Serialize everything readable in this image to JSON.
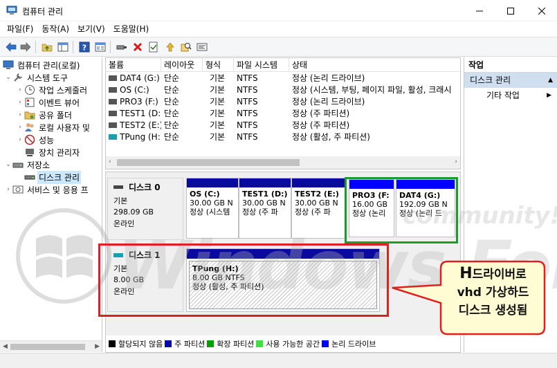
{
  "window": {
    "title": "컴퓨터 관리",
    "icon": "computer-management-icon"
  },
  "menu": [
    "파일(F)",
    "동작(A)",
    "보기(V)",
    "도움말(H)"
  ],
  "toolbar": [
    "back-arrow-icon",
    "forward-arrow-icon",
    "up-folder-icon",
    "show-hide-tree-icon",
    "help-icon",
    "properties-icon",
    "connect-icon",
    "delete-icon",
    "check-icon",
    "upload-icon",
    "search-icon",
    "settings-icon"
  ],
  "tree": {
    "root": "컴퓨터 관리(로컬)",
    "items": [
      {
        "label": "시스템 도구",
        "level": 1,
        "expanded": true,
        "icon": "tools-icon"
      },
      {
        "label": "작업 스케줄러",
        "level": 2,
        "icon": "clock-icon"
      },
      {
        "label": "이벤트 뷰어",
        "level": 2,
        "icon": "event-viewer-icon"
      },
      {
        "label": "공유 폴더",
        "level": 2,
        "icon": "shared-folder-icon"
      },
      {
        "label": "로컬 사용자 및",
        "level": 2,
        "icon": "users-icon"
      },
      {
        "label": "성능",
        "level": 2,
        "icon": "performance-icon"
      },
      {
        "label": "장치 관리자",
        "level": 2,
        "icon": "device-manager-icon"
      },
      {
        "label": "저장소",
        "level": 1,
        "expanded": true,
        "icon": "storage-icon"
      },
      {
        "label": "디스크 관리",
        "level": 2,
        "selected": true,
        "icon": "disk-icon"
      },
      {
        "label": "서비스 및 응용 프",
        "level": 1,
        "icon": "services-icon"
      }
    ]
  },
  "volumes": {
    "columns": [
      "볼륨",
      "레이아웃",
      "형식",
      "파일 시스템",
      "상태"
    ],
    "rows": [
      [
        "DAT4 (G:)",
        "단순",
        "기본",
        "NTFS",
        "정상 (논리 드라이브)"
      ],
      [
        "OS (C:)",
        "단순",
        "기본",
        "NTFS",
        "정상 (시스템, 부팅, 페이지 파일, 활성, 크래시"
      ],
      [
        "PRO3 (F:)",
        "단순",
        "기본",
        "NTFS",
        "정상 (논리 드라이브)"
      ],
      [
        "TEST1 (D:)",
        "단순",
        "기본",
        "NTFS",
        "정상 (주 파티션)"
      ],
      [
        "TEST2 (E:)",
        "단순",
        "기본",
        "NTFS",
        "정상 (주 파티션)"
      ],
      [
        "TPung (H:)",
        "단순",
        "기본",
        "NTFS",
        "정상 (활성, 주 파티션)"
      ]
    ]
  },
  "disks": [
    {
      "name": "디스크 0",
      "type": "기본",
      "size": "298.09 GB",
      "status": "온라인",
      "partitions": [
        {
          "name": "OS  (C:)",
          "size": "30.00 GB N",
          "status": "정상 (시스템",
          "kind": "primary"
        },
        {
          "name": "TEST1  (D:)",
          "size": "30.00 GB N",
          "status": "정상 (주 파",
          "kind": "primary"
        },
        {
          "name": "TEST2  (E:)",
          "size": "30.00 GB N",
          "status": "정상 (주 파",
          "kind": "primary"
        },
        {
          "name": "PRO3  (F:",
          "size": "16.00 GB",
          "status": "정상 (논리",
          "kind": "logical"
        },
        {
          "name": "DAT4  (G:)",
          "size": "192.09 GB N",
          "status": "정상 (논리 드",
          "kind": "logical"
        }
      ]
    },
    {
      "name": "디스크 1",
      "type": "기본",
      "size": "8.00 GB",
      "status": "온라인",
      "partitions": [
        {
          "name": "TPung  (H:)",
          "size": "8.00 GB NTFS",
          "status": "정상 (활성, 주 파티션)",
          "kind": "primary"
        }
      ]
    }
  ],
  "legend": [
    {
      "label": "할당되지 않음",
      "color": "#000000"
    },
    {
      "label": "주 파티션",
      "color": "#0a0aa0"
    },
    {
      "label": "확장 파티션",
      "color": "#00a000"
    },
    {
      "label": "사용 가능한 공간",
      "color": "#44dd44"
    },
    {
      "label": "논리 드라이브",
      "color": "#0000ff"
    }
  ],
  "actions": {
    "header": "작업",
    "section": "디스크 관리",
    "item": "기타 작업"
  },
  "callout": {
    "line1_big": "H",
    "line1_rest": "드라이버로",
    "line2": "vhd 가상하드",
    "line3": "디스크 생성됨"
  },
  "watermark": {
    "brand": "Windows Forum",
    "tagline": "community!"
  },
  "colors": {
    "primary": "#0a0aa0",
    "logical": "#0000ff",
    "highlight_green": "#1a9c2c",
    "highlight_red": "#e02020",
    "callout_fill": "#fffbd2",
    "callout_border": "#e02020",
    "selection": "#cce8ff"
  }
}
